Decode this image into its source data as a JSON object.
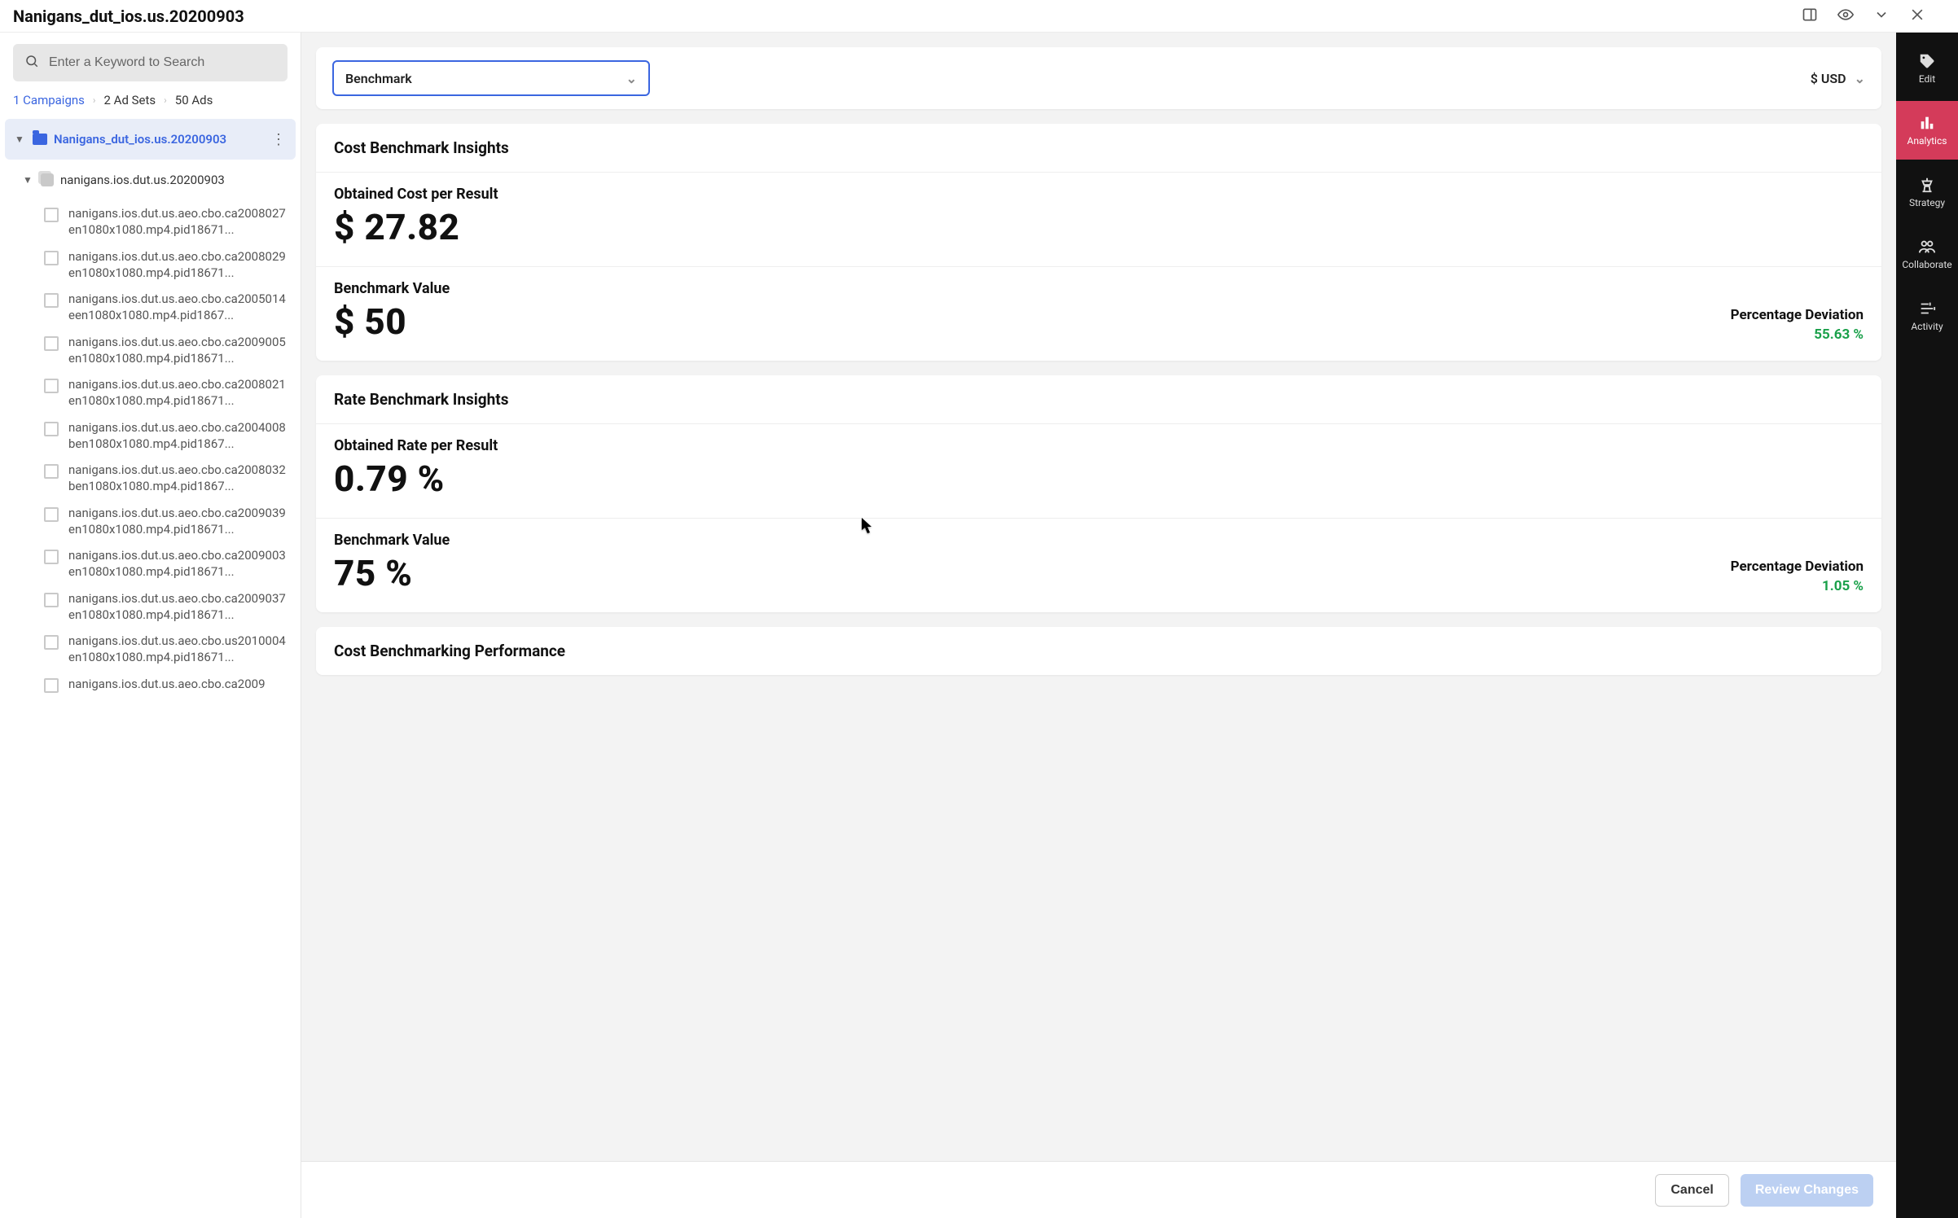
{
  "title": "Nanigans_dut_ios.us.20200903",
  "search": {
    "placeholder": "Enter a Keyword to Search"
  },
  "breadcrumbs": {
    "campaigns": "1 Campaigns",
    "adsets": "2 Ad Sets",
    "ads": "50 Ads"
  },
  "tree": {
    "campaign": "Nanigans_dut_ios.us.20200903",
    "adset": "nanigans.ios.dut.us.20200903",
    "ads": [
      "nanigans.ios.dut.us.aeo.cbo.ca2008027en1080x1080.mp4.pid18671...",
      "nanigans.ios.dut.us.aeo.cbo.ca2008029en1080x1080.mp4.pid18671...",
      "nanigans.ios.dut.us.aeo.cbo.ca2005014een1080x1080.mp4.pid1867...",
      "nanigans.ios.dut.us.aeo.cbo.ca2009005en1080x1080.mp4.pid18671...",
      "nanigans.ios.dut.us.aeo.cbo.ca2008021en1080x1080.mp4.pid18671...",
      "nanigans.ios.dut.us.aeo.cbo.ca2004008ben1080x1080.mp4.pid1867...",
      "nanigans.ios.dut.us.aeo.cbo.ca2008032ben1080x1080.mp4.pid1867...",
      "nanigans.ios.dut.us.aeo.cbo.ca2009039en1080x1080.mp4.pid18671...",
      "nanigans.ios.dut.us.aeo.cbo.ca2009003en1080x1080.mp4.pid18671...",
      "nanigans.ios.dut.us.aeo.cbo.ca2009037en1080x1080.mp4.pid18671...",
      "nanigans.ios.dut.us.aeo.cbo.us2010004en1080x1080.mp4.pid18671...",
      "nanigans.ios.dut.us.aeo.cbo.ca2009"
    ]
  },
  "controls": {
    "tab_select": "Benchmark",
    "currency": "$ USD"
  },
  "cost_insights": {
    "header": "Cost Benchmark Insights",
    "obtained_label": "Obtained Cost per Result",
    "obtained_value": "$ 27.82",
    "benchmark_label": "Benchmark Value",
    "benchmark_value": "$ 50",
    "deviation_label": "Percentage Deviation",
    "deviation_value": "55.63 %"
  },
  "rate_insights": {
    "header": "Rate Benchmark Insights",
    "obtained_label": "Obtained Rate per Result",
    "obtained_value": "0.79 %",
    "benchmark_label": "Benchmark Value",
    "benchmark_value": "75 %",
    "deviation_label": "Percentage Deviation",
    "deviation_value": "1.05 %"
  },
  "cost_perf_header": "Cost Benchmarking Performance",
  "footer": {
    "cancel": "Cancel",
    "review": "Review Changes"
  },
  "rightnav": {
    "edit": "Edit",
    "analytics": "Analytics",
    "strategy": "Strategy",
    "collaborate": "Collaborate",
    "activity": "Activity"
  }
}
